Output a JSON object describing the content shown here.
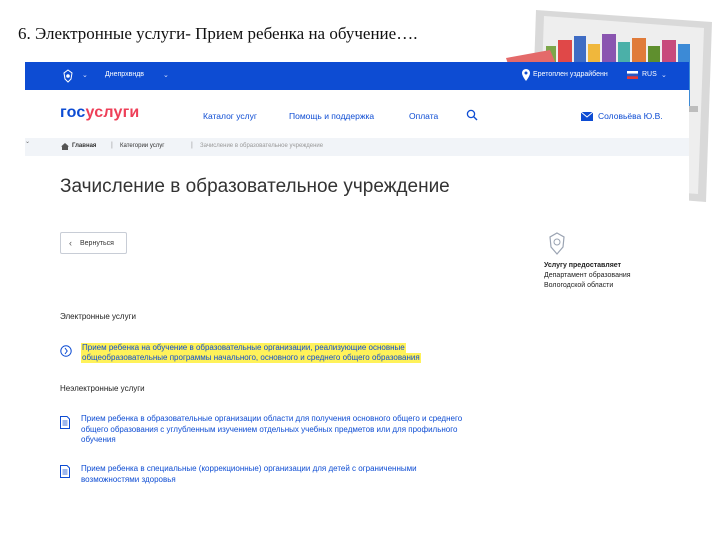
{
  "slide": {
    "title": "6. Электронные услуги- Прием ребенка на обучение…."
  },
  "topbar": {
    "region": "Днепрхвндв",
    "city": "Еретоплен уздрайбенн",
    "lang": "RUS"
  },
  "header": {
    "logo_part1": "гос",
    "logo_part2": "услуги",
    "nav": [
      "Каталог услуг",
      "Помощь и поддержка",
      "Оплата"
    ],
    "user": "Соловьёва Ю.В."
  },
  "breadcrumbs": [
    "Главная",
    "Категории услуг",
    "Зачисление в образовательное учреждение"
  ],
  "page": {
    "title": "Зачисление в образовательное учреждение",
    "back_label": "Вернуться"
  },
  "provider": {
    "line1": "Услугу предоставляет",
    "line2": "Департамент образования",
    "line3": "Вологодской области"
  },
  "electronic": {
    "heading": "Электронные услуги",
    "item_lines": [
      "Прием ребенка на обучение в образовательные организации, реализующие основные",
      "общеобразовательные программы начального, основного и среднего общего образования"
    ]
  },
  "non_electronic": {
    "heading": "Неэлектронные услуги",
    "items": [
      {
        "lines": [
          "Прием ребенка в образовательные организации области для получения основного общего и среднего",
          "общего образования с углубленным изучением отдельных учебных предметов или для профильного",
          "обучения"
        ]
      },
      {
        "lines": [
          "Прием ребенка в специальные (коррекционные) организации для детей с ограниченными",
          "возможностями здоровья"
        ]
      }
    ]
  },
  "colors": {
    "brand_blue": "#0d4cd3",
    "brand_red": "#ee3f58",
    "highlight": "#fff25a"
  }
}
